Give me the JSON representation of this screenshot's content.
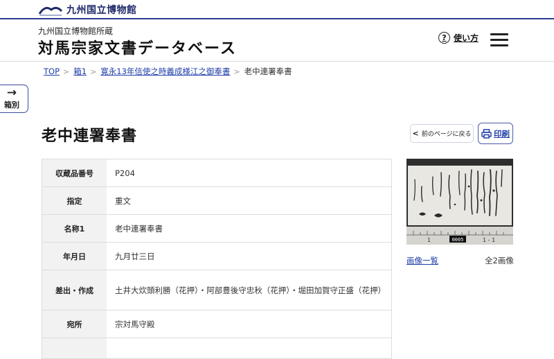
{
  "site": {
    "museum_name": "九州国立博物館"
  },
  "header": {
    "subtitle": "九州国立博物館所蔵",
    "title": "対馬宗家文書データベース",
    "help_label": "使い方",
    "help_glyph": "?"
  },
  "breadcrumb": {
    "items": [
      "TOP",
      "箱1",
      "寛永13年信使之時義成様江之御奉書"
    ],
    "current": "老中連署奉書",
    "separator": ">"
  },
  "side_nav": {
    "arrow": "→",
    "label": "箱別"
  },
  "page": {
    "title": "老中連署奉書",
    "back_label": "前のページに戻る",
    "back_glyph": "<",
    "print_label": "印刷"
  },
  "details": [
    {
      "label": "収蔵品番号",
      "value": "P204"
    },
    {
      "label": "指定",
      "value": "重文"
    },
    {
      "label": "名称1",
      "value": "老中連署奉書"
    },
    {
      "label": "年月日",
      "value": "九月廿三日"
    },
    {
      "label": "差出・作成",
      "value": "土井大炊頭利勝（花押）・阿部豊後守忠秋（花押）・堀田加賀守正盛（花押）"
    },
    {
      "label": "宛所",
      "value": "宗対馬守殿"
    }
  ],
  "images": {
    "list_label": "画像一覧",
    "count_label": "全2画像",
    "thumb_frame_number": "0005",
    "thumb_page_label": "1 - 1",
    "thumb_ruler_mark": "1"
  },
  "colors": {
    "accent": "#1f3ea8",
    "border_dark": "#2b3a8c",
    "label_bg": "#f2f2f2"
  }
}
